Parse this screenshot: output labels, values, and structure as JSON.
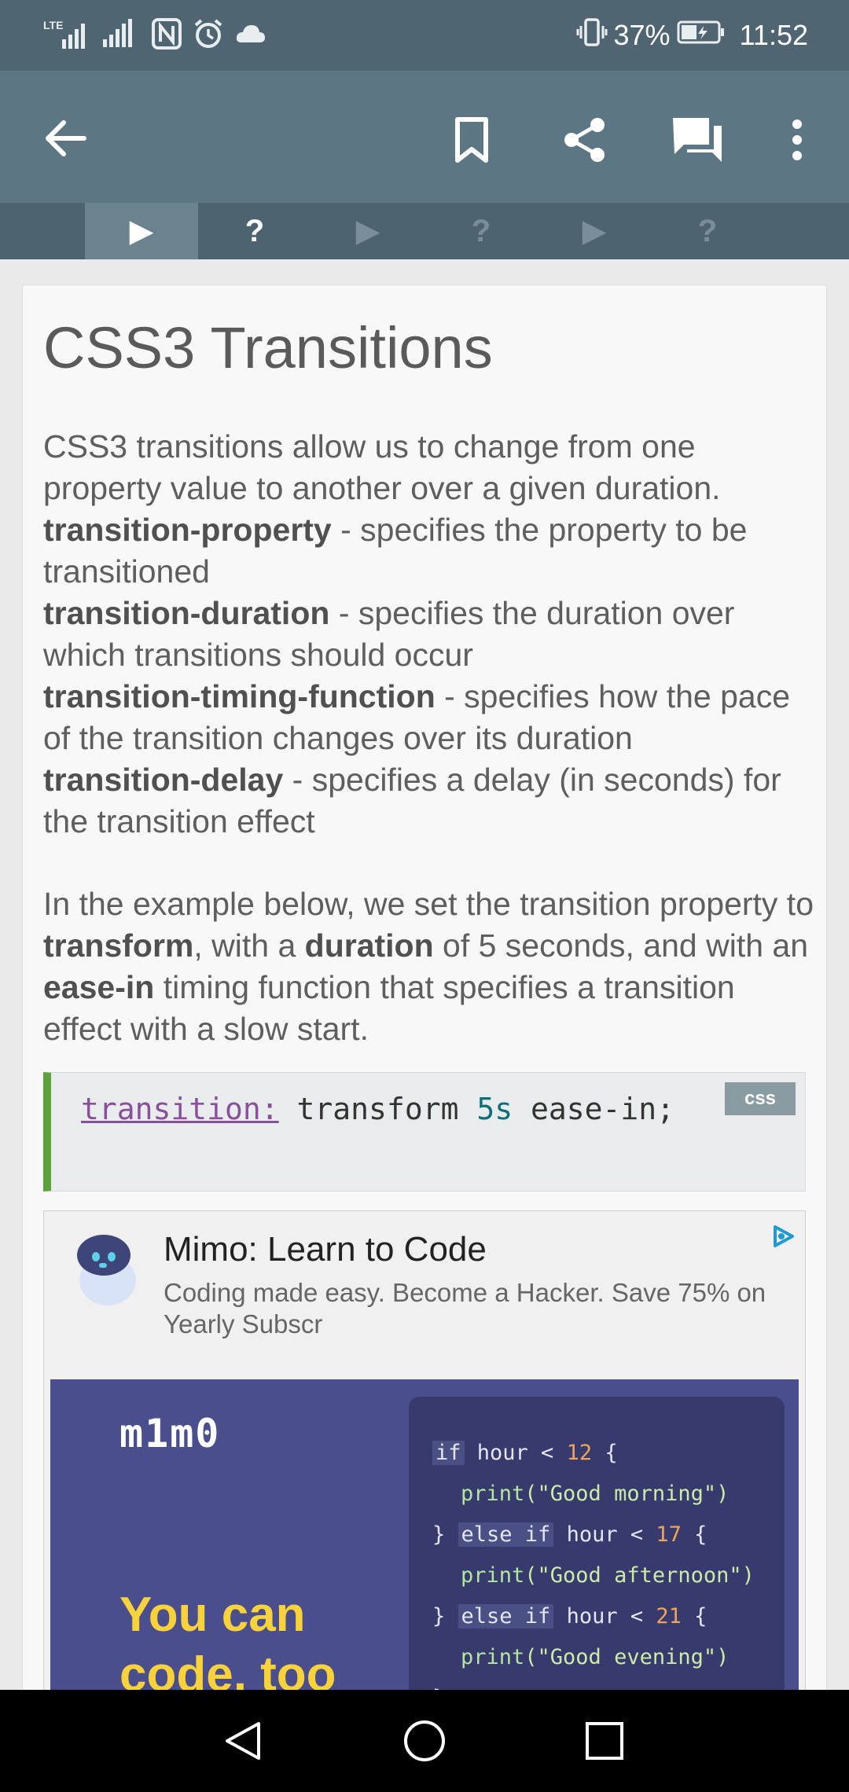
{
  "status_bar": {
    "network_label": "LTE",
    "battery_percent": "37%",
    "time": "11:52"
  },
  "toolbar": {
    "icons": [
      "back-arrow-icon",
      "bookmark-icon",
      "share-icon",
      "comments-icon",
      "more-vertical-icon"
    ]
  },
  "steps": [
    {
      "type": "lesson",
      "glyph": "▶",
      "active": true
    },
    {
      "type": "quiz",
      "glyph": "?",
      "active": false
    },
    {
      "type": "lesson",
      "glyph": "▶",
      "active": false
    },
    {
      "type": "quiz",
      "glyph": "?",
      "active": false
    },
    {
      "type": "lesson",
      "glyph": "▶",
      "active": false
    },
    {
      "type": "quiz",
      "glyph": "?",
      "active": false
    }
  ],
  "lesson": {
    "title": "CSS3 Transitions",
    "intro": "CSS3 transitions allow us to change from one property value to another over a given duration.",
    "definitions": [
      {
        "term": "transition-property",
        "desc": " - specifies the property to be transitioned"
      },
      {
        "term": "transition-duration",
        "desc": " - specifies the duration over which transitions should occur"
      },
      {
        "term": "transition-timing-function",
        "desc": " - specifies how the pace of the transition changes over its duration"
      },
      {
        "term": "transition-delay",
        "desc": " - specifies a delay (in seconds) for the transition effect"
      }
    ],
    "example_text": {
      "p1": "In the example below, we set the transition property to ",
      "b1": "transform",
      "p2": ", with a ",
      "b2": "duration",
      "p3": " of 5 sec­onds, and with an ",
      "b3": "ease-in",
      "p4": " timing function that specifies a transition effect with a slow start."
    }
  },
  "code": {
    "property": "transition:",
    "value_before": " transform ",
    "number": "5s",
    "value_after": " ease-in;",
    "language": "css"
  },
  "ad": {
    "title": "Mimo: Learn to Code",
    "description": "Coding made easy. Become a Hacker. Save 75% on Yearly Subscr",
    "banner_brand": "m1m0",
    "banner_slogan": "You can code, too",
    "code_lines": [
      {
        "indent": 0,
        "kw": "if",
        "text": " hour < ",
        "num": "12",
        "tail": " {"
      },
      {
        "indent": 1,
        "fn": "print",
        "str": "(\"Good morning\")"
      },
      {
        "indent": 0,
        "pre": "} ",
        "kw": "else if",
        "text": " hour < ",
        "num": "17",
        "tail": " {"
      },
      {
        "indent": 1,
        "fn": "print",
        "str": "(\"Good afternoon\")"
      },
      {
        "indent": 0,
        "pre": "} ",
        "kw": "else if",
        "text": " hour < ",
        "num": "21",
        "tail": " {"
      },
      {
        "indent": 1,
        "fn": "print",
        "str": "(\"Good evening\")"
      },
      {
        "indent": 0,
        "pre": "}"
      }
    ]
  },
  "nav_bar": {
    "icons": [
      "nav-back-icon",
      "nav-home-icon",
      "nav-recents-icon"
    ]
  },
  "colors": {
    "toolbar": "#5c7684",
    "status_bar": "#4f6572",
    "code_accent": "#5aa33b",
    "ad_banner": "#4a4e8c",
    "slogan": "#f7d23b"
  }
}
